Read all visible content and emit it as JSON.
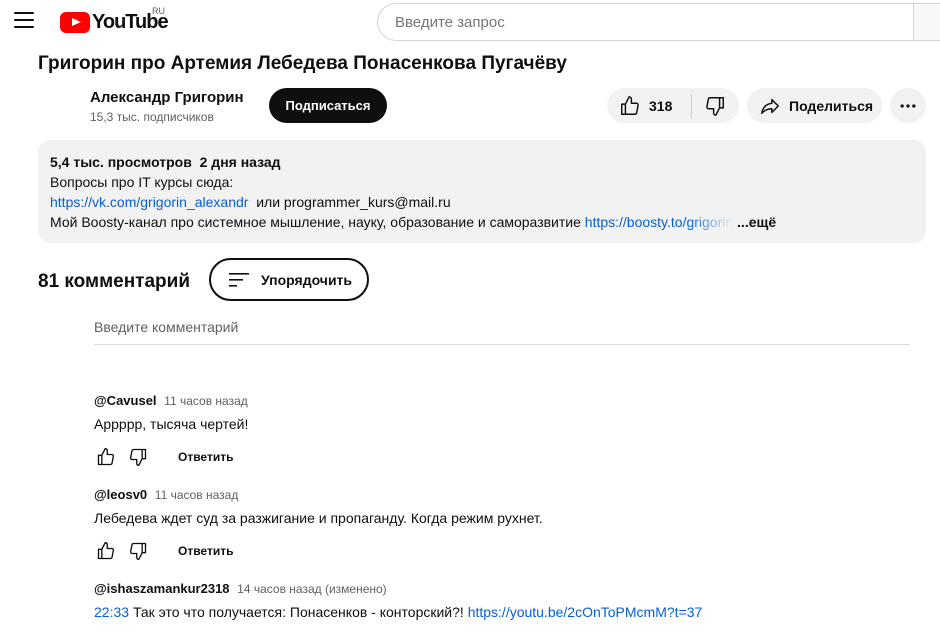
{
  "header": {
    "logo_text": "YouTube",
    "country_code": "RU",
    "search_placeholder": "Введите запрос"
  },
  "video": {
    "title": "Григорин про Артемия Лебедева Понасенкова Пугачёву",
    "channel_name": "Александр Григорин",
    "subscribers": "15,3 тыс. подписчиков",
    "subscribe_label": "Подписаться",
    "likes": "318",
    "share_label": "Поделиться"
  },
  "description": {
    "views": "5,4 тыс. просмотров",
    "date": "2 дня назад",
    "line1": "Вопросы про IT курсы сюда:",
    "link1": "https://vk.com/grigorin_alexandr",
    "or_text": "или programmer_kurs@mail.ru",
    "line3_text": "Мой Boosty-канал про системное мышление, науку, образование и саморазвитие",
    "link2": "https://boosty.to/grigorin",
    "more_label": "...ещё"
  },
  "comments_section": {
    "count_label": "81 комментарий",
    "sort_label": "Упорядочить",
    "input_placeholder": "Введите комментарий",
    "reply_label": "Ответить",
    "items": [
      {
        "author": "@Cavusel",
        "time": "11 часов назад",
        "text": "Аррррр, тысяча чертей!"
      },
      {
        "author": "@leosv0",
        "time": "11 часов назад",
        "text": "Лебедева ждет суд за разжигание и пропаганду. Когда режим рухнет."
      },
      {
        "author": "@ishaszamankur2318",
        "time": "14 часов назад (изменено)",
        "timestamp_link": "22:33",
        "text": "Так это что получается: Понасенков - конторский?!",
        "link": "https://youtu.be/2cOnToPMcmM?t=37"
      }
    ]
  }
}
